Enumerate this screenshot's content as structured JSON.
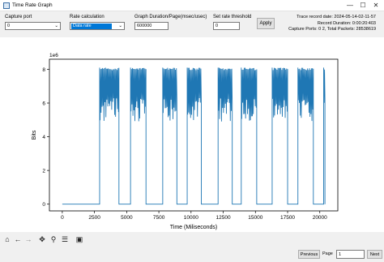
{
  "window": {
    "title": "Time Rate Graph",
    "minimize": "—",
    "maximize": "☐",
    "close": "✕"
  },
  "controls": {
    "capture_port": {
      "label": "Capture port",
      "value": "0"
    },
    "rate_calc": {
      "label": "Rate calculation",
      "value": "Data rate"
    },
    "graph_duration": {
      "label": "Graph Duration/Page(msec/usec)",
      "value": "600000"
    },
    "threshold": {
      "label": "Set rate threshold",
      "value": "0"
    },
    "apply": "Apply"
  },
  "info": {
    "trace_date": "Trace record date: 2024-05-14-02-11-57",
    "duration": "Record Duration: 0:00:20:403",
    "ports": "Capture Ports: 0 2, Total Packets: 28538619"
  },
  "toolbar": {
    "home": "⌂",
    "back": "←",
    "forward": "→",
    "pan": "✥",
    "zoom": "⚲",
    "configure": "☰",
    "save": "▣"
  },
  "pager": {
    "previous": "Previous",
    "page_label": "Page",
    "page_value": "1",
    "next": "Next"
  },
  "chart_data": {
    "type": "line",
    "xlabel": "Time (Miliseconds)",
    "ylabel": "Bits",
    "exponent_label": "1e6",
    "xlim": [
      -1000,
      21400
    ],
    "ylim": [
      -0.4,
      8.6
    ],
    "xticks": [
      0,
      2500,
      5000,
      7500,
      10000,
      12500,
      15000,
      17500,
      20000
    ],
    "yticks": [
      0,
      2,
      4,
      6,
      8
    ],
    "color": "#1f77b4",
    "bursts": [
      {
        "start": 2900,
        "end": 4400,
        "high": 8.1,
        "low": 4.9
      },
      {
        "start": 5300,
        "end": 6500,
        "high": 8.1,
        "low": 4.9
      },
      {
        "start": 7800,
        "end": 8900,
        "high": 8.1,
        "low": 4.9
      },
      {
        "start": 9700,
        "end": 10800,
        "high": 8.1,
        "low": 4.9
      },
      {
        "start": 12100,
        "end": 13200,
        "high": 8.1,
        "low": 4.9
      },
      {
        "start": 13900,
        "end": 15100,
        "high": 8.1,
        "low": 4.9
      },
      {
        "start": 16300,
        "end": 17500,
        "high": 8.1,
        "low": 4.9
      },
      {
        "start": 18300,
        "end": 19500,
        "high": 8.1,
        "low": 4.9
      },
      {
        "start": 20300,
        "end": 20400,
        "high": 8.1,
        "low": 4.9
      }
    ],
    "baseline": 0,
    "x_start": 0,
    "x_end": 20400
  }
}
